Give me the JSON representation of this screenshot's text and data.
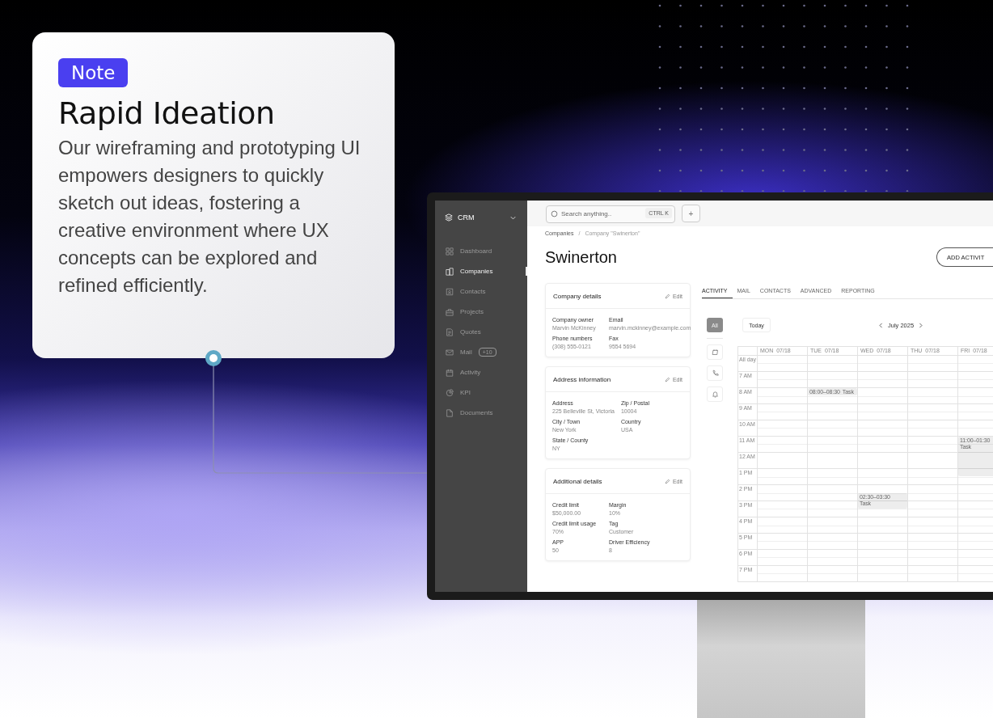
{
  "note": {
    "badge": "Note",
    "title": "Rapid Ideation",
    "body": "Our wireframing and prototyping UI empowers designers to quickly sketch out ideas, fostering a creative environment where UX concepts can be explored and refined efficiently."
  },
  "app": {
    "brand": "CRM",
    "search": {
      "placeholder": "Search anything..",
      "shortcut": "CTRL K"
    },
    "add_button": "+",
    "sidebar": {
      "items": [
        {
          "label": "Dashboard",
          "selected": false
        },
        {
          "label": "Companies",
          "selected": true
        },
        {
          "label": "Contacts",
          "selected": false
        },
        {
          "label": "Projects",
          "selected": false
        },
        {
          "label": "Quotes",
          "selected": false
        },
        {
          "label": "Mail",
          "badge": "+10",
          "selected": false
        },
        {
          "label": "Activity",
          "selected": false
        },
        {
          "label": "KPI",
          "selected": false
        },
        {
          "label": "Documents",
          "selected": false
        }
      ]
    },
    "breadcrumb": {
      "separator": "/",
      "items": [
        "Companies",
        "Company \"Swinerton\""
      ]
    },
    "page_title": "Swinerton",
    "action_button": "ADD ACTIVIT",
    "cards": [
      {
        "title": "Company details",
        "edit": "Edit",
        "fields": [
          {
            "label": "Company owner",
            "value": "Marvin McKinney"
          },
          {
            "label": "Email",
            "value": "marvin.mckinney@example.com"
          },
          {
            "label": "Phone numbers",
            "value": "(308) 555-0121"
          },
          {
            "label": "Fax",
            "value": "9554 5694"
          }
        ]
      },
      {
        "title": "Address information",
        "edit": "Edit",
        "fields": [
          {
            "label": "Address",
            "value": "225 Belleville St, Victoria"
          },
          {
            "label": "Zip / Postal",
            "value": "10004"
          },
          {
            "label": "City / Town",
            "value": "New York"
          },
          {
            "label": "Country",
            "value": "USA"
          },
          {
            "label": "State / County",
            "value": "NY"
          }
        ]
      },
      {
        "title": "Additional details",
        "edit": "Edit",
        "fields": [
          {
            "label": "Credit limit",
            "value": "$50,000.00"
          },
          {
            "label": "Margin",
            "value": "10%"
          },
          {
            "label": "Credit limit usage",
            "value": "70%"
          },
          {
            "label": "Tag",
            "value": "Customer"
          },
          {
            "label": "APP",
            "value": "50"
          },
          {
            "label": "Driver Efficiency",
            "value": "8"
          }
        ]
      }
    ],
    "tabs": [
      {
        "label": "ACTIVITY",
        "selected": true
      },
      {
        "label": "MAIL",
        "selected": false
      },
      {
        "label": "CONTACTS",
        "selected": false
      },
      {
        "label": "ADVANCED",
        "selected": false
      },
      {
        "label": "REPORTING",
        "selected": false
      }
    ],
    "filters": [
      {
        "kind": "all",
        "label": "All",
        "selected": true
      },
      {
        "kind": "note",
        "selected": false
      },
      {
        "kind": "call",
        "selected": false
      },
      {
        "kind": "reminder",
        "selected": false
      }
    ],
    "calendar": {
      "today": "Today",
      "month": "July 2025",
      "days": [
        {
          "name": "MON",
          "date": "07/18"
        },
        {
          "name": "TUE",
          "date": "07/18",
          "events": [
            {
              "time": "08:00–08:30",
              "title": "Task"
            }
          ]
        },
        {
          "name": "WED",
          "date": "07/18",
          "events": [
            {
              "time": "02:30–03:30",
              "title": "Task"
            }
          ]
        },
        {
          "name": "THU",
          "date": "07/18"
        },
        {
          "name": "FRI",
          "date": "07/18",
          "events": [
            {
              "time": "11:00–01:30",
              "title": "Task"
            }
          ]
        }
      ],
      "hours": [
        "All day",
        "7 AM",
        "8 AM",
        "9 AM",
        "10 AM",
        "11 AM",
        "12 AM",
        "1 PM",
        "2 PM",
        "3 PM",
        "4 PM",
        "5 PM",
        "6 PM",
        "7 PM"
      ]
    }
  }
}
